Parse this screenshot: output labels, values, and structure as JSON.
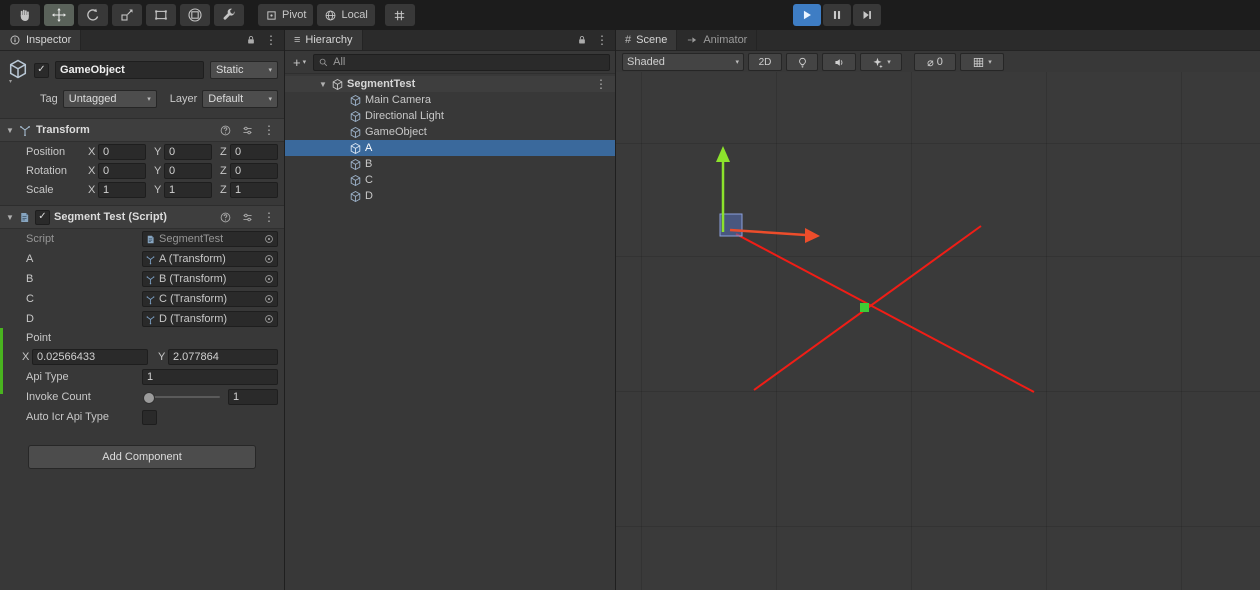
{
  "icons": {
    "foldout": "▼",
    "dropdown": "▾",
    "kebab": "⋮",
    "check": "✓",
    "plus": "+",
    "hash": "#",
    "list": "≡",
    "diameter": "⌀"
  },
  "toolbar": {
    "pivot_label": "Pivot",
    "local_label": "Local"
  },
  "inspector": {
    "tab_label": "Inspector",
    "gameobject": {
      "name": "GameObject",
      "static_label": "Static",
      "tag_label": "Tag",
      "tag_value": "Untagged",
      "layer_label": "Layer",
      "layer_value": "Default"
    },
    "transform": {
      "title": "Transform",
      "axis_x_label": "X",
      "axis_y_label": "Y",
      "axis_z_label": "Z",
      "rows": [
        {
          "label": "Position",
          "x": "0",
          "y": "0",
          "z": "0"
        },
        {
          "label": "Rotation",
          "x": "0",
          "y": "0",
          "z": "0"
        },
        {
          "label": "Scale",
          "x": "1",
          "y": "1",
          "z": "1"
        }
      ]
    },
    "segment_test": {
      "title": "Segment Test (Script)",
      "script_label": "Script",
      "script_value": "SegmentTest",
      "refs": [
        {
          "label": "A",
          "value": "A (Transform)"
        },
        {
          "label": "B",
          "value": "B (Transform)"
        },
        {
          "label": "C",
          "value": "C (Transform)"
        },
        {
          "label": "D",
          "value": "D (Transform)"
        }
      ],
      "point_label": "Point",
      "point_x_label": "X",
      "point_x_value": "0.02566433",
      "point_y_label": "Y",
      "point_y_value": "2.077864",
      "api_type_label": "Api Type",
      "api_type_value": "1",
      "invoke_count_label": "Invoke Count",
      "invoke_count_value": "1",
      "auto_icr_label": "Auto Icr Api Type"
    },
    "add_component_label": "Add Component"
  },
  "hierarchy": {
    "tab_label": "Hierarchy",
    "search_value": "All",
    "root_label": "SegmentTest",
    "items": [
      {
        "label": "Main Camera"
      },
      {
        "label": "Directional Light"
      },
      {
        "label": "GameObject"
      },
      {
        "label": "A",
        "selected": true
      },
      {
        "label": "B"
      },
      {
        "label": "C"
      },
      {
        "label": "D"
      }
    ]
  },
  "scene": {
    "tab_scene_label": "Scene",
    "tab_animator_label": "Animator",
    "shaded_label": "Shaded",
    "mode_2d_label": "2D",
    "visibility_count": "0",
    "colors": {
      "axis_x": "#ED4D2B",
      "axis_y": "#8CE32C",
      "segment_line": "#F01D16",
      "point": "#3FCB34",
      "selection": "#3A699C",
      "play_active": "#3E7DC4"
    }
  }
}
